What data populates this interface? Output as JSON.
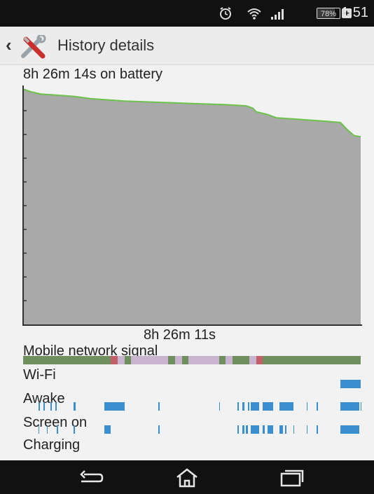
{
  "status_bar": {
    "time": "1:51",
    "battery_percent": "78%",
    "battery_level": 0.78,
    "charging_plus": "+",
    "icons": [
      "alarm-icon",
      "wifi-icon",
      "signal-icon",
      "battery-icon"
    ]
  },
  "action_bar": {
    "back_glyph": "‹",
    "title": "History details",
    "icon": "tools-icon"
  },
  "summary": {
    "on_battery": "8h 26m 14s on battery",
    "duration": "8h 26m 11s"
  },
  "chart_data": {
    "type": "area",
    "title": "",
    "xlabel": "8h 26m 11s",
    "ylabel": "",
    "y_unit": "battery level (fraction of full)",
    "ylim": [
      0,
      1
    ],
    "xlim": [
      0,
      1
    ],
    "x": [
      0,
      0.02,
      0.05,
      0.1,
      0.15,
      0.2,
      0.3,
      0.4,
      0.5,
      0.6,
      0.66,
      0.68,
      0.69,
      0.72,
      0.75,
      0.8,
      0.9,
      0.94,
      0.96,
      0.98,
      1.0
    ],
    "y": [
      0.99,
      0.98,
      0.97,
      0.965,
      0.96,
      0.95,
      0.94,
      0.935,
      0.93,
      0.925,
      0.92,
      0.91,
      0.895,
      0.885,
      0.87,
      0.865,
      0.855,
      0.85,
      0.82,
      0.795,
      0.79
    ],
    "fill_color": "#a9a9a9",
    "line_color": "#6cc24a",
    "grid": false
  },
  "rows": [
    {
      "label": "Mobile network signal",
      "name": "mobile-network-signal"
    },
    {
      "label": "Wi-Fi",
      "name": "wifi"
    },
    {
      "label": "Awake",
      "name": "awake"
    },
    {
      "label": "Screen on",
      "name": "screen-on"
    },
    {
      "label": "Charging",
      "name": "charging"
    }
  ],
  "colors": {
    "signal_good": "#6f8f5e",
    "signal_poor": "#c8b4cf",
    "signal_none": "#c2606a",
    "activity": "#3a8fd0"
  },
  "navigation": {
    "back": "back-icon",
    "home": "home-icon",
    "recents": "recents-icon"
  }
}
